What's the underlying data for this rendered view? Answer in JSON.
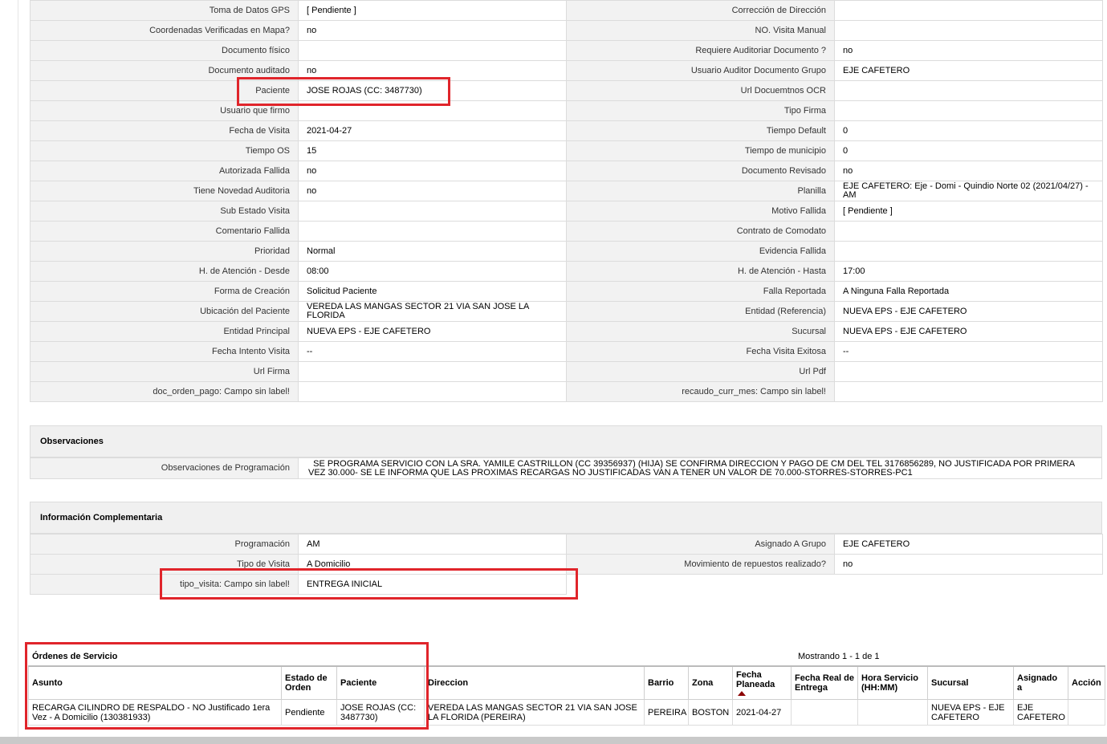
{
  "detail_rows": [
    {
      "l1": "Toma de Datos GPS",
      "v1": "[ Pendiente ]",
      "l2": "Corrección de Dirección",
      "v2": ""
    },
    {
      "l1": "Coordenadas Verificadas en Mapa?",
      "v1": "no",
      "l2": "NO. Visita Manual",
      "v2": ""
    },
    {
      "l1": "Documento físico",
      "v1": "",
      "l2": "Requiere Auditoriar Documento ?",
      "v2": "no"
    },
    {
      "l1": "Documento auditado",
      "v1": "no",
      "l2": "Usuario Auditor Documento Grupo",
      "v2": "EJE CAFETERO"
    },
    {
      "l1": "Paciente",
      "v1": "JOSE ROJAS (CC: 3487730)",
      "l2": "Url Docuemtnos OCR",
      "v2": ""
    },
    {
      "l1": "Usuario que firmo",
      "v1": "",
      "l2": "Tipo Firma",
      "v2": ""
    },
    {
      "l1": "Fecha de Visita",
      "v1": "2021-04-27",
      "l2": "Tiempo Default",
      "v2": "0"
    },
    {
      "l1": "Tiempo OS",
      "v1": "15",
      "l2": "Tiempo de municipio",
      "v2": "0"
    },
    {
      "l1": "Autorizada Fallida",
      "v1": "no",
      "l2": "Documento Revisado",
      "v2": "no"
    },
    {
      "l1": "Tiene Novedad Auditoria",
      "v1": "no",
      "l2": "Planilla",
      "v2": "EJE CAFETERO: Eje - Domi - Quindio Norte 02 (2021/04/27) - AM"
    },
    {
      "l1": "Sub Estado Visita",
      "v1": "",
      "l2": "Motivo Fallida",
      "v2": "[ Pendiente ]"
    },
    {
      "l1": "Comentario Fallida",
      "v1": "",
      "l2": "Contrato de Comodato",
      "v2": ""
    },
    {
      "l1": "Prioridad",
      "v1": "Normal",
      "l2": "Evidencia Fallida",
      "v2": ""
    },
    {
      "l1": "H. de Atención - Desde",
      "v1": "08:00",
      "l2": "H. de Atención - Hasta",
      "v2": "17:00"
    },
    {
      "l1": "Forma de Creación",
      "v1": "Solicitud Paciente",
      "l2": "Falla Reportada",
      "v2": "A Ninguna Falla Reportada"
    },
    {
      "l1": "Ubicación del Paciente",
      "v1": "VEREDA LAS MANGAS SECTOR 21 VIA SAN JOSE LA FLORIDA",
      "l2": "Entidad (Referencia)",
      "v2": "NUEVA EPS - EJE CAFETERO"
    },
    {
      "l1": "Entidad Principal",
      "v1": "NUEVA EPS - EJE CAFETERO",
      "l2": "Sucursal",
      "v2": "NUEVA EPS - EJE CAFETERO"
    },
    {
      "l1": "Fecha Intento Visita",
      "v1": "--",
      "l2": "Fecha Visita Exitosa",
      "v2": "--"
    },
    {
      "l1": "Url Firma",
      "v1": "",
      "l2": "Url Pdf",
      "v2": ""
    },
    {
      "l1": "doc_orden_pago: Campo sin label!",
      "v1": "",
      "l2": "recaudo_curr_mes: Campo sin label!",
      "v2": ""
    }
  ],
  "observaciones": {
    "title": "Observaciones",
    "label": "Observaciones de Programación",
    "value": "SE PROGRAMA SERVICIO CON LA SRA. YAMILE CASTRILLON (CC 39356937) (HIJA) SE CONFIRMA DIRECCION Y PAGO DE CM DEL TEL 3176856289, NO JUSTIFICADA POR PRIMERA VEZ 30.000- SE LE INFORMA QUE LAS PROXIMAS RECARGAS NO JUSTIFICADAS VAN A TENER UN VALOR DE 70.000-STORRES-STORRES-PC1"
  },
  "complementaria": {
    "title": "Información Complementaria",
    "rows": [
      {
        "l1": "Programación",
        "v1": "AM",
        "l2": "Asignado A Grupo",
        "v2": "EJE CAFETERO"
      },
      {
        "l1": "Tipo de Visita",
        "v1": "A Domicilio",
        "l2": "Movimiento de repuestos realizado?",
        "v2": "no"
      },
      {
        "l1": "tipo_visita: Campo sin label!",
        "v1": "ENTREGA INICIAL"
      }
    ]
  },
  "ordenes": {
    "title": "Órdenes de Servicio",
    "mostrando": "Mostrando 1 - 1 de 1",
    "headers": [
      "Asunto",
      "Estado de Orden",
      "Paciente",
      "Direccion",
      "Barrio",
      "Zona",
      "Fecha Planeada",
      "Fecha Real de Entrega",
      "Hora Servicio (HH:MM)",
      "Sucursal",
      "Asignado a",
      "Acción"
    ],
    "row": [
      "RECARGA CILINDRO DE RESPALDO - NO Justificado 1era Vez - A Domicilio (130381933)",
      "Pendiente",
      "JOSE ROJAS (CC: 3487730)",
      "VEREDA LAS MANGAS SECTOR 21 VIA SAN JOSE LA FLORIDA (PEREIRA)",
      "PEREIRA",
      "BOSTON",
      "2021-04-27",
      "",
      "",
      "NUEVA EPS - EJE CAFETERO",
      "EJE CAFETERO",
      ""
    ]
  },
  "colors": {
    "highlight": "#e0252b",
    "label_bg": "#f2f2f2",
    "border": "#dcdcdc"
  }
}
